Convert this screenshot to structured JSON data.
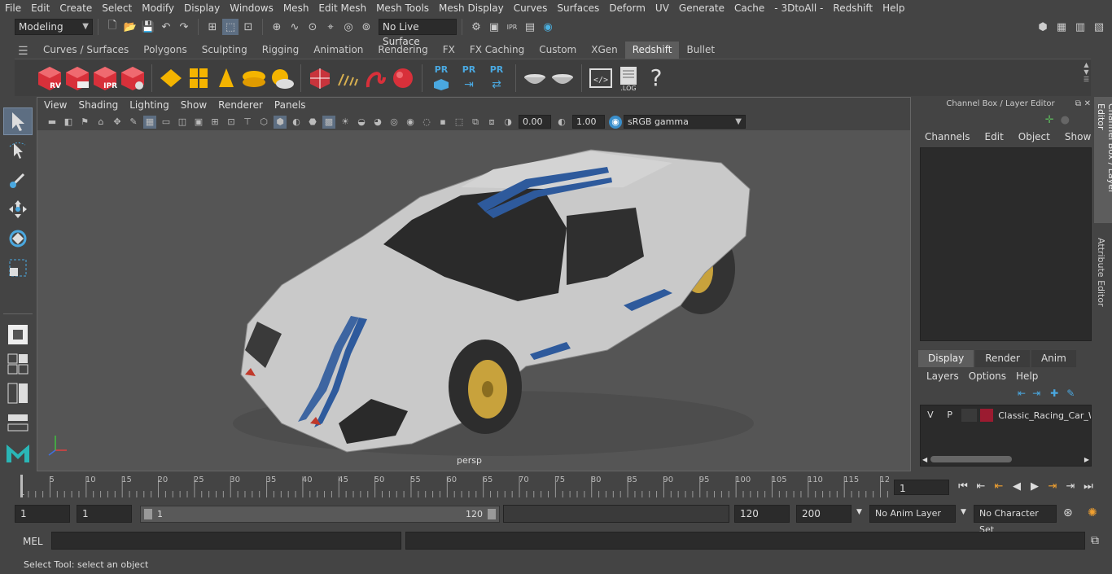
{
  "menubar": {
    "items": [
      "File",
      "Edit",
      "Create",
      "Select",
      "Modify",
      "Display",
      "Windows",
      "Mesh",
      "Edit Mesh",
      "Mesh Tools",
      "Mesh Display",
      "Curves",
      "Surfaces",
      "Deform",
      "UV",
      "Generate",
      "Cache",
      "- 3DtoAll -",
      "Redshift",
      "Help"
    ]
  },
  "statusline": {
    "mode": "Modeling",
    "live_surface": "No Live Surface"
  },
  "shelf": {
    "tabs": [
      "Curves / Surfaces",
      "Polygons",
      "Sculpting",
      "Rigging",
      "Animation",
      "Rendering",
      "FX",
      "FX Caching",
      "Custom",
      "XGen",
      "Redshift",
      "Bullet"
    ],
    "active_tab": "Redshift",
    "rs_labels": [
      "RV",
      "",
      "IPR",
      ""
    ],
    "pr_labels": [
      "PR",
      "PR",
      "PR"
    ],
    "log_label": ".LOG",
    "help_label": "?"
  },
  "viewport": {
    "menu": [
      "View",
      "Shading",
      "Lighting",
      "Show",
      "Renderer",
      "Panels"
    ],
    "exposure": "0.00",
    "gamma": "1.00",
    "color_space": "sRGB gamma",
    "camera_label": "persp"
  },
  "channelbox": {
    "title": "Channel Box / Layer Editor",
    "menu": [
      "Channels",
      "Edit",
      "Object",
      "Show"
    ],
    "layer_tabs": [
      "Display",
      "Render",
      "Anim"
    ],
    "layer_menu": [
      "Layers",
      "Options",
      "Help"
    ],
    "layer": {
      "v": "V",
      "p": "P",
      "name": "Classic_Racing_Car_Wh",
      "color": "#9b1b30"
    }
  },
  "side_tabs": [
    "Channel Box / Layer Editor",
    "Attribute Editor"
  ],
  "timeslider": {
    "ticks": [
      "5",
      "10",
      "15",
      "20",
      "25",
      "30",
      "35",
      "40",
      "45",
      "50",
      "55",
      "60",
      "65",
      "70",
      "75",
      "80",
      "85",
      "90",
      "95",
      "100",
      "105",
      "110",
      "115",
      "12"
    ],
    "start_label": "1",
    "current_frame": "1"
  },
  "range": {
    "start": "1",
    "playback_start": "1",
    "slider_start": "1",
    "slider_end": "120",
    "playback_end": "120",
    "end": "200",
    "anim_layer": "No Anim Layer",
    "character_set": "No Character Set"
  },
  "cmdline": {
    "label": "MEL"
  },
  "helpline": {
    "text": "Select Tool: select an object"
  },
  "colors": {
    "accent": "#5d6e82",
    "redshift": "#d8303a",
    "stripe": "#2e5a9c"
  }
}
